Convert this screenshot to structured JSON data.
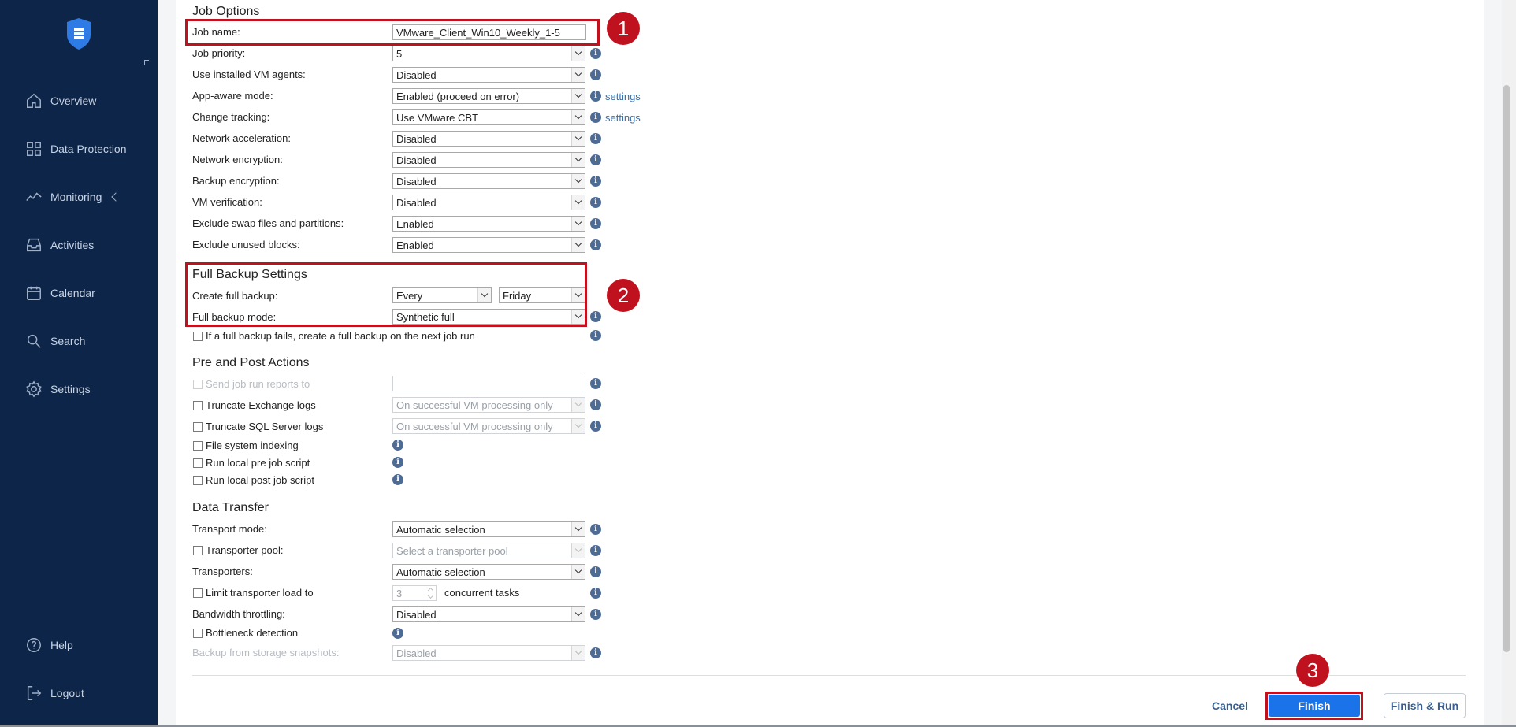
{
  "sidebar": {
    "items": [
      {
        "label": "Overview",
        "icon": "home-icon"
      },
      {
        "label": "Data Protection",
        "icon": "grid-icon"
      },
      {
        "label": "Monitoring",
        "icon": "activity-line-icon"
      },
      {
        "label": "Activities",
        "icon": "inbox-icon"
      },
      {
        "label": "Calendar",
        "icon": "calendar-icon"
      },
      {
        "label": "Search",
        "icon": "search-icon"
      },
      {
        "label": "Settings",
        "icon": "gear-icon"
      }
    ],
    "bottom": [
      {
        "label": "Help",
        "icon": "help-circle-icon"
      },
      {
        "label": "Logout",
        "icon": "logout-icon"
      }
    ]
  },
  "job_options": {
    "title": "Job Options",
    "job_name_label": "Job name:",
    "job_name_value": "VMware_Client_Win10_Weekly_1-5",
    "rows": [
      {
        "label": "Job priority:",
        "value": "5"
      },
      {
        "label": "Use installed VM agents:",
        "value": "Disabled"
      },
      {
        "label": "App-aware mode:",
        "value": "Enabled (proceed on error)",
        "link": "settings"
      },
      {
        "label": "Change tracking:",
        "value": "Use VMware CBT",
        "link": "settings"
      },
      {
        "label": "Network acceleration:",
        "value": "Disabled"
      },
      {
        "label": "Network encryption:",
        "value": "Disabled"
      },
      {
        "label": "Backup encryption:",
        "value": "Disabled"
      },
      {
        "label": "VM verification:",
        "value": "Disabled"
      },
      {
        "label": "Exclude swap files and partitions:",
        "value": "Enabled"
      },
      {
        "label": "Exclude unused blocks:",
        "value": "Enabled"
      }
    ]
  },
  "full_backup": {
    "title": "Full Backup Settings",
    "create_label": "Create full backup:",
    "create_every": "Every",
    "create_day": "Friday",
    "mode_label": "Full backup mode:",
    "mode_value": "Synthetic full",
    "fail_checkbox": "If a full backup fails, create a full backup on the next job run"
  },
  "pre_post": {
    "title": "Pre and Post Actions",
    "send_reports": "Send job run reports to",
    "truncate_exchange": "Truncate Exchange logs",
    "truncate_exchange_value": "On successful VM processing only",
    "truncate_sql": "Truncate SQL Server logs",
    "truncate_sql_value": "On successful VM processing only",
    "fs_indexing": "File system indexing",
    "pre_script": "Run local pre job script",
    "post_script": "Run local post job script"
  },
  "data_transfer": {
    "title": "Data Transfer",
    "transport_mode_label": "Transport mode:",
    "transport_mode_value": "Automatic selection",
    "transporter_pool_label": "Transporter pool:",
    "transporter_pool_placeholder": "Select a transporter pool",
    "transporters_label": "Transporters:",
    "transporters_value": "Automatic selection",
    "limit_label": "Limit transporter load to",
    "limit_value": "3",
    "limit_suffix": "concurrent tasks",
    "bandwidth_label": "Bandwidth throttling:",
    "bandwidth_value": "Disabled",
    "bottleneck_label": "Bottleneck detection",
    "storage_snapshots_label": "Backup from storage snapshots:",
    "storage_snapshots_value": "Disabled"
  },
  "footer": {
    "cancel": "Cancel",
    "finish": "Finish",
    "finish_run": "Finish & Run"
  },
  "annotations": [
    "1",
    "2",
    "3"
  ],
  "colors": {
    "sidebar_bg": "#0d2548",
    "accent": "#1a73e8",
    "highlight": "#c0111f"
  }
}
